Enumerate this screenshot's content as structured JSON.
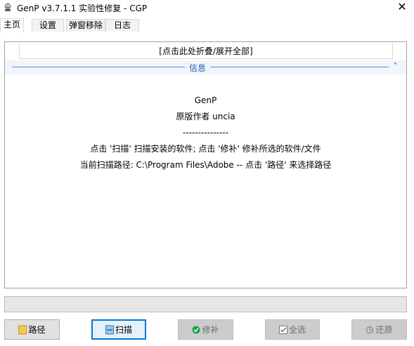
{
  "window": {
    "title": "GenP v3.7.1.1 实验性修复 - CGP",
    "close_glyph": "✕"
  },
  "tabs": [
    {
      "label": "主页"
    },
    {
      "label": "设置"
    },
    {
      "label": "弹窗移除"
    },
    {
      "label": "日志"
    }
  ],
  "panel": {
    "collapse_all": "[点击此处折叠/展开全部]",
    "info_header": "信息",
    "chevron_glyph": "˄",
    "lines": [
      "GenP",
      "原版作者 uncia",
      "---------------",
      "点击 '扫描' 扫描安装的软件; 点击 '修补' 修补所选的软件/文件",
      "当前扫描路径: C:\\Program Files\\Adobe -- 点击 '路径' 来选择路径"
    ]
  },
  "progress": {
    "value": 0
  },
  "buttons": {
    "path": "路径",
    "scan": "扫描",
    "patch": "修补",
    "select_all": "全选",
    "restore": "还原"
  },
  "icons": {
    "app": "genp-app-icon",
    "path": "folder-icon",
    "scan": "scan-icon",
    "patch": "shield-check-icon",
    "select_all": "checkbox-icon",
    "restore": "restore-icon"
  },
  "colors": {
    "accent": "#0078d7",
    "info_line": "#5b8fd3",
    "patch_icon": "#1aa34a",
    "folder_icon": "#f2c94c"
  }
}
